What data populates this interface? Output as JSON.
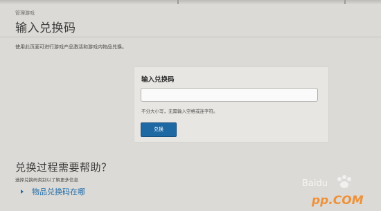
{
  "header": {
    "breadcrumb": "管理游戏",
    "title": "输入兑换码"
  },
  "intro": {
    "text": "使用此页面可进行游戏产品激活和游戏内物品兑换。"
  },
  "redeem": {
    "panel_title": "输入兑换码",
    "input_value": "",
    "input_placeholder": "",
    "hint": "不分大小写，无需输入空格或连字符。",
    "button_label": "兑换",
    "button_color": "#1e68a3"
  },
  "help": {
    "heading": "兑换过程需要帮助？",
    "subtext": "选择兑换码类别以了解更多信息",
    "link_label": "物品兑换码在哪",
    "link_icon": "chevron-right-icon",
    "link_color": "#1f6ba8"
  },
  "watermark": {
    "brand": "Baidu",
    "site": "pp.COM"
  }
}
